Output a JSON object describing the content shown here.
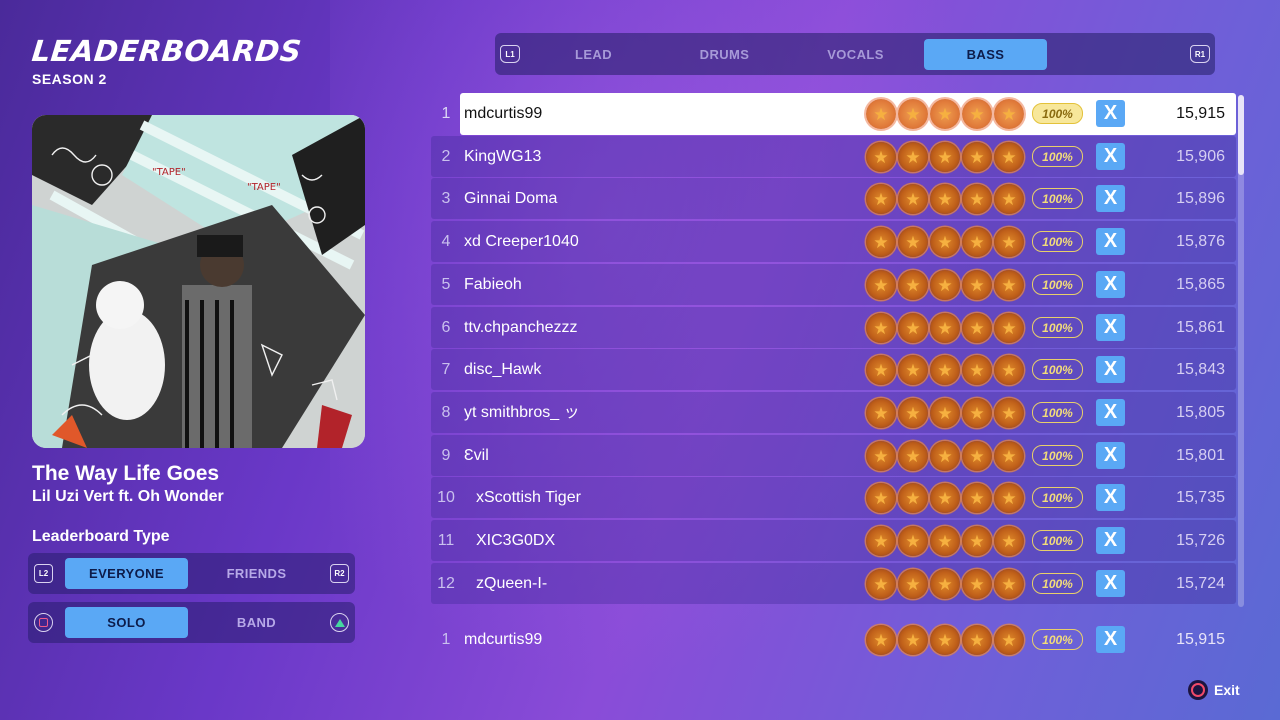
{
  "header": {
    "title": "LEADERBOARDS",
    "season": "SEASON 2"
  },
  "song": {
    "title": "The Way Life Goes",
    "artist": "Lil Uzi Vert ft. Oh Wonder"
  },
  "leaderboard_type": {
    "label": "Leaderboard Type",
    "scope": {
      "left_ctrl": "L2",
      "right_ctrl": "R2",
      "options": [
        "EVERYONE",
        "FRIENDS"
      ],
      "selected": "EVERYONE"
    },
    "mode": {
      "options": [
        "SOLO",
        "BAND"
      ],
      "selected": "SOLO"
    }
  },
  "tabs": {
    "left_ctrl": "L1",
    "right_ctrl": "R1",
    "items": [
      {
        "label": "LEAD"
      },
      {
        "label": "DRUMS"
      },
      {
        "label": "VOCALS"
      },
      {
        "label": "BASS"
      }
    ],
    "selected": "BASS"
  },
  "entries": [
    {
      "rank": "1",
      "name": "mdcurtis99",
      "stars": 5,
      "accuracy": "100%",
      "fc": "X",
      "score": "15,915",
      "highlighted": true
    },
    {
      "rank": "2",
      "name": "KingWG13",
      "stars": 5,
      "accuracy": "100%",
      "fc": "X",
      "score": "15,906"
    },
    {
      "rank": "3",
      "name": "Ginnai Doma",
      "stars": 5,
      "accuracy": "100%",
      "fc": "X",
      "score": "15,896"
    },
    {
      "rank": "4",
      "name": "xd Creeper1040",
      "stars": 5,
      "accuracy": "100%",
      "fc": "X",
      "score": "15,876"
    },
    {
      "rank": "5",
      "name": "Fabieoh",
      "stars": 5,
      "accuracy": "100%",
      "fc": "X",
      "score": "15,865"
    },
    {
      "rank": "6",
      "name": "ttv.chpanchezzz",
      "stars": 5,
      "accuracy": "100%",
      "fc": "X",
      "score": "15,861"
    },
    {
      "rank": "7",
      "name": "disc_Hawk",
      "stars": 5,
      "accuracy": "100%",
      "fc": "X",
      "score": "15,843"
    },
    {
      "rank": "8",
      "name": "yt smithbros_ ッ",
      "stars": 5,
      "accuracy": "100%",
      "fc": "X",
      "score": "15,805"
    },
    {
      "rank": "9",
      "name": "Ɛvil",
      "stars": 5,
      "accuracy": "100%",
      "fc": "X",
      "score": "15,801"
    },
    {
      "rank": "10",
      "name": "xScottish Tiger",
      "stars": 5,
      "accuracy": "100%",
      "fc": "X",
      "score": "15,735"
    },
    {
      "rank": "11",
      "name": "XIC3G0DX",
      "stars": 5,
      "accuracy": "100%",
      "fc": "X",
      "score": "15,726"
    },
    {
      "rank": "12",
      "name": "zQueen-I-",
      "stars": 5,
      "accuracy": "100%",
      "fc": "X",
      "score": "15,724"
    }
  ],
  "self_entry": {
    "rank": "1",
    "name": "mdcurtis99",
    "stars": 5,
    "accuracy": "100%",
    "fc": "X",
    "score": "15,915"
  },
  "footer": {
    "exit_label": "Exit"
  },
  "colors": {
    "accent": "#5aa8f5",
    "star": "#e08a2a",
    "accuracy": "#f2dc7a"
  },
  "icons": {
    "star": "star-icon",
    "full_combo": "full-combo-x-icon",
    "exit": "circle-button-icon"
  }
}
